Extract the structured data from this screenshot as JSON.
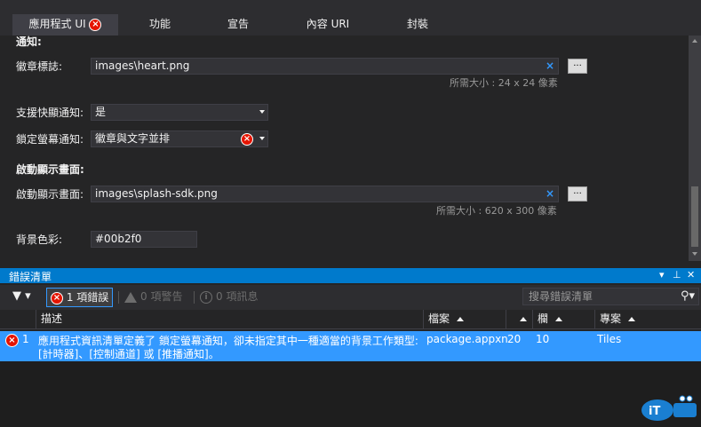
{
  "tabs": [
    {
      "label": "應用程式 UI",
      "has_error": true
    },
    {
      "label": "功能"
    },
    {
      "label": "宣告"
    },
    {
      "label": "內容 URI"
    },
    {
      "label": "封裝"
    }
  ],
  "designer": {
    "section_notifications": "通知:",
    "badge_logo_label": "徽章標誌:",
    "badge_logo_value": "images\\heart.png",
    "badge_logo_hint": "所需大小 : 24 x 24 像素",
    "toast_label": "支援快顯通知:",
    "toast_value": "是",
    "lock_label": "鎖定螢幕通知:",
    "lock_value": "徽章與文字並排",
    "section_splash": "啟動顯示畫面:",
    "splash_label": "啟動顯示畫面:",
    "splash_value": "images\\splash-sdk.png",
    "splash_hint": "所需大小 : 620 x 300 像素",
    "bg_label": "背景色彩:",
    "bg_value": "#00b2f0",
    "browse_label": "...",
    "clear_glyph": "×"
  },
  "error_list": {
    "title": "錯誤清單",
    "errors_filter": "1 項錯誤",
    "warnings_filter": "0 項警告",
    "messages_filter": "0 項訊息",
    "search_placeholder": "搜尋錯誤清單",
    "columns": {
      "description": "描述",
      "file": "檔案",
      "line": "",
      "column": "欄",
      "project": "專案"
    },
    "rows": [
      {
        "index": "1",
        "description_line1": "應用程式資訊清單定義了 鎖定螢幕通知，卻未指定其中一種適當的背景工作類型:",
        "description_line2": "[計時器]、[控制通道] 或 [推播通知]。",
        "file": "package.appxn",
        "line": "20",
        "column": "10",
        "project": "Tiles"
      }
    ]
  },
  "colors": {
    "accent": "#007acc",
    "selection": "#3399ff",
    "error": "#e51400",
    "panel": "#252526"
  }
}
